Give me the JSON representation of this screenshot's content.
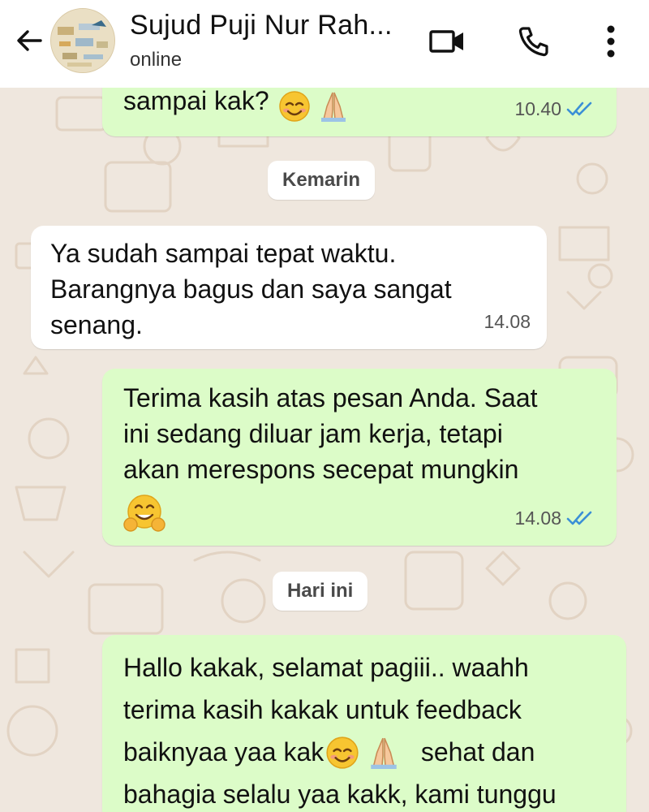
{
  "header": {
    "contact_name": "Sujud Puji Nur Rah...",
    "status": "online",
    "icons": {
      "back": "arrow-left-icon",
      "video": "video-call-icon",
      "call": "phone-icon",
      "menu": "more-vertical-icon"
    }
  },
  "messages": [
    {
      "direction": "out",
      "text": "sampai kak?",
      "time": "10.40",
      "read": true
    },
    {
      "type": "date",
      "label": "Kemarin"
    },
    {
      "direction": "in",
      "text": "Ya sudah sampai tepat waktu. Barangnya bagus dan saya sangat senang.",
      "lines": [
        "Ya sudah sampai tepat waktu.",
        "Barangnya bagus dan saya sangat",
        "senang."
      ],
      "time": "14.08"
    },
    {
      "direction": "out",
      "lines": [
        "Terima kasih atas pesan Anda. Saat",
        "ini sedang diluar jam kerja, tetapi",
        "akan merespons secepat mungkin"
      ],
      "time": "14.08",
      "read": true
    },
    {
      "type": "date",
      "label": "Hari ini"
    },
    {
      "direction": "out",
      "lines": [
        "Hallo kakak, selamat pagiii.. waahh",
        "terima kasih kakak untuk feedback",
        "baiknyaa yaa kak",
        "sehat dan",
        "bahagia selalu yaa kakk, kami tunggu"
      ]
    }
  ],
  "colors": {
    "outgoing_bubble": "#dcfcc8",
    "incoming_bubble": "#ffffff",
    "read_ticks": "#3b8fd6",
    "wallpaper": "#efe7de"
  }
}
